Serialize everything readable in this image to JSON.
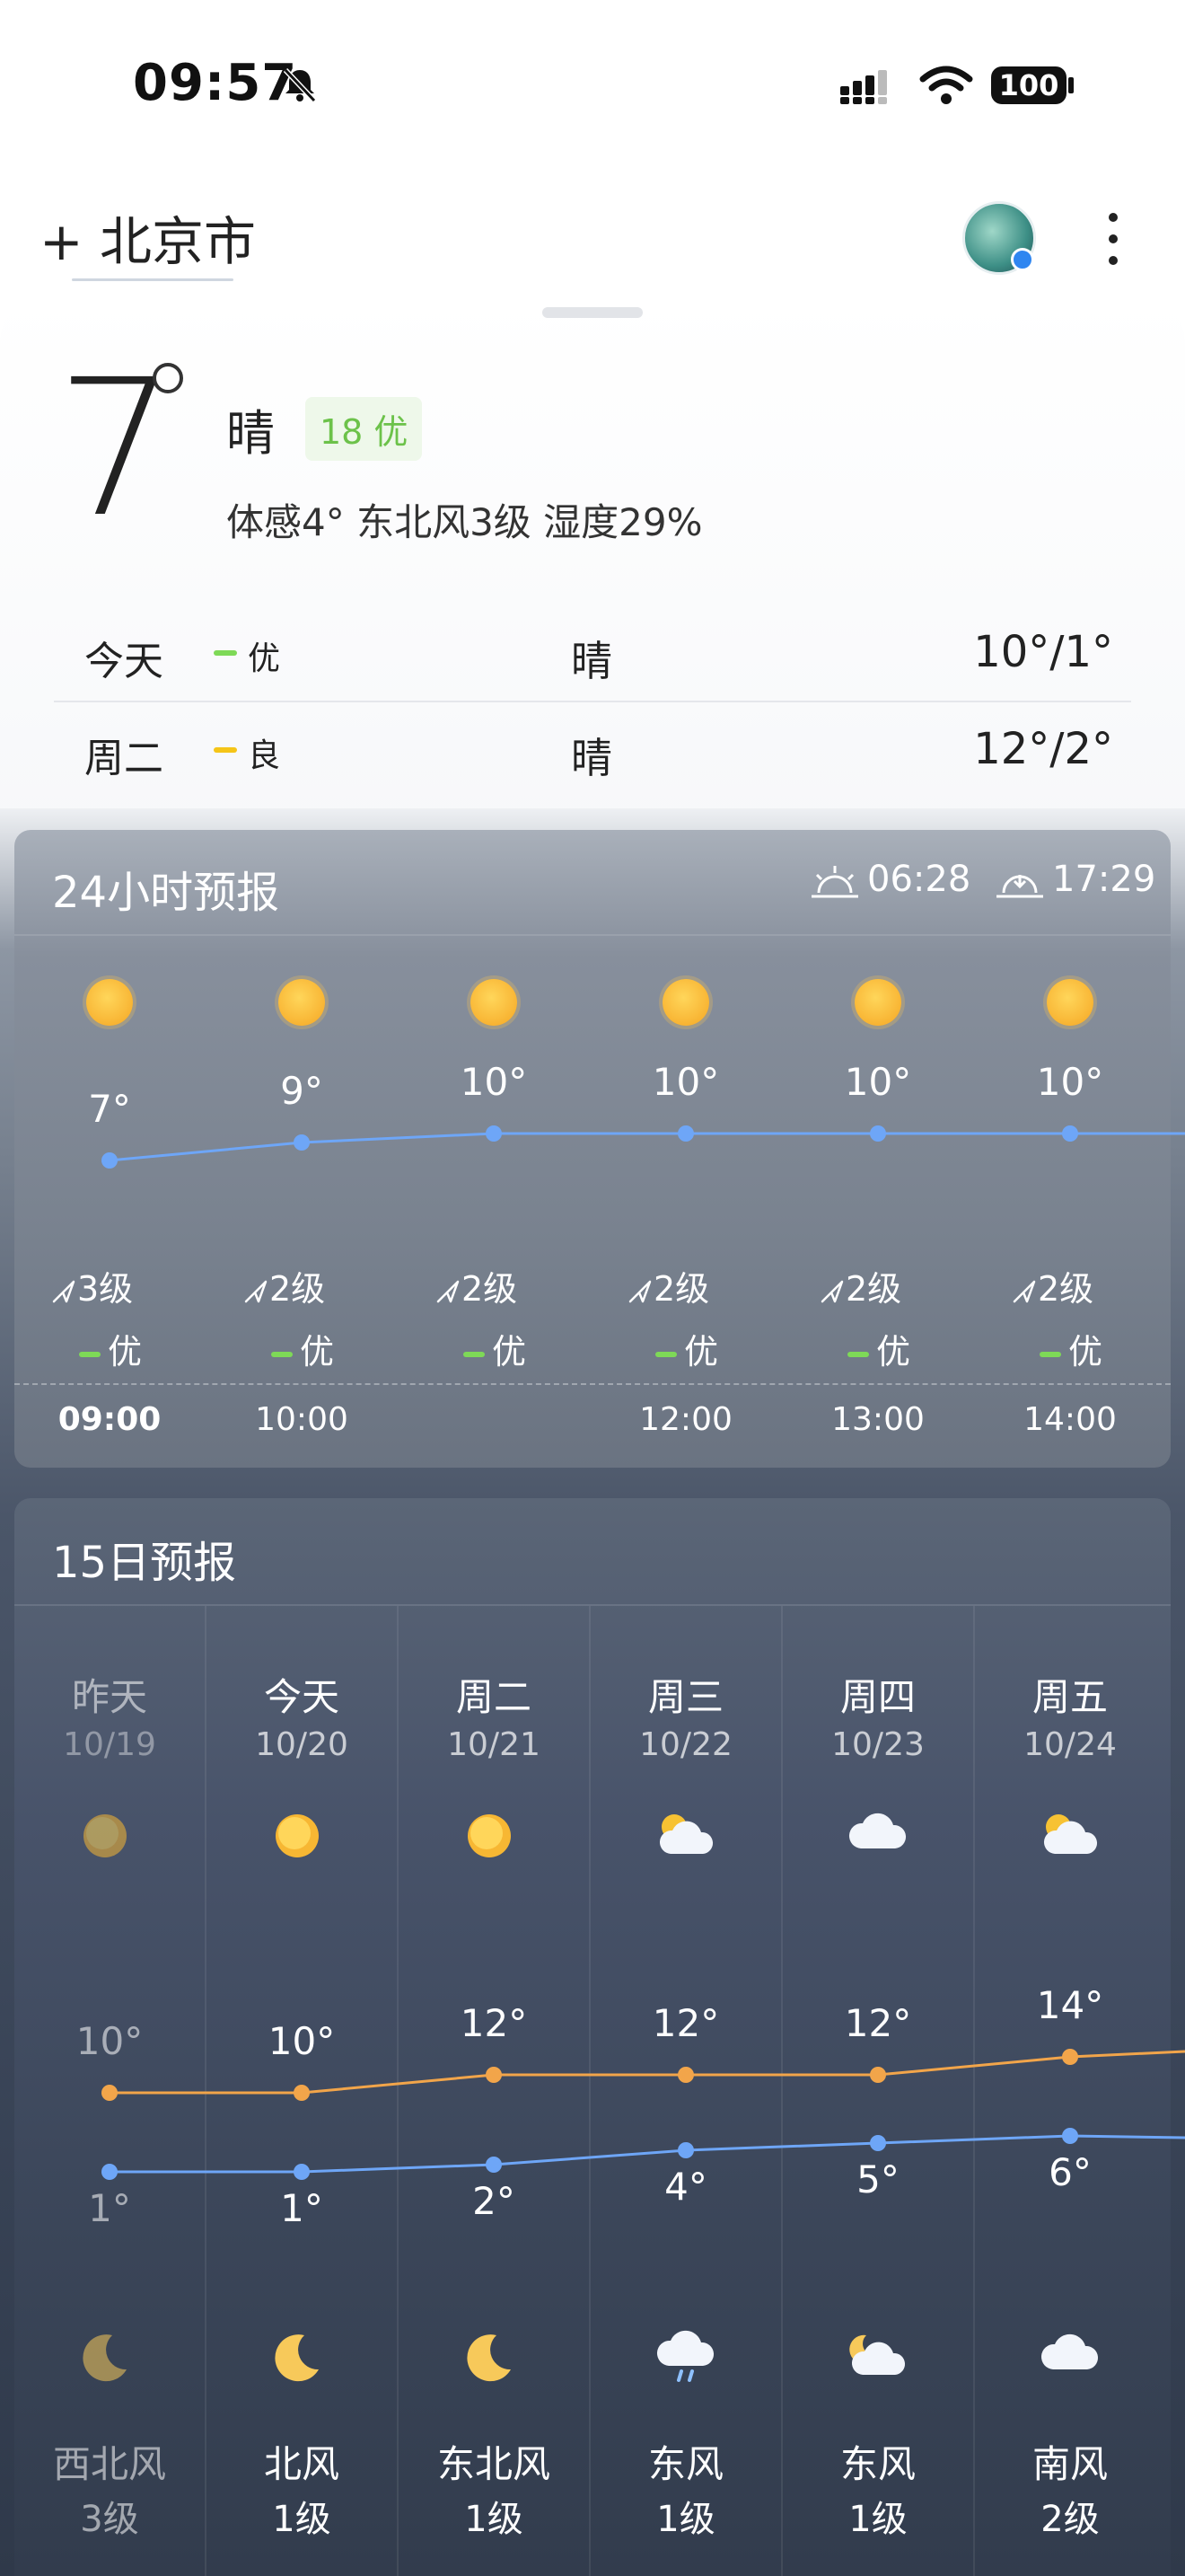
{
  "status_bar": {
    "time": "09:57",
    "battery": "100"
  },
  "header": {
    "city": "+ 北京市"
  },
  "current": {
    "temperature": "7",
    "condition": "晴",
    "aqi": "18 优",
    "details": "体感4° 东北风3级 湿度29%",
    "days": [
      {
        "name": "今天",
        "aqi": "优",
        "aqi_color": "#7ed957",
        "condition": "晴",
        "temps": "10°/1°"
      },
      {
        "name": "周二",
        "aqi": "良",
        "aqi_color": "#f5c518",
        "condition": "晴",
        "temps": "12°/2°"
      }
    ]
  },
  "hourly": {
    "title": "24小时预报",
    "sunrise": "06:28",
    "sunset": "17:29",
    "hours": [
      {
        "time": "09:00",
        "temp": "7°",
        "wind": "3级",
        "aqi": "优"
      },
      {
        "time": "10:00",
        "temp": "9°",
        "wind": "2级",
        "aqi": "优"
      },
      {
        "time": "",
        "temp": "10°",
        "wind": "2级",
        "aqi": "优"
      },
      {
        "time": "12:00",
        "temp": "10°",
        "wind": "2级",
        "aqi": "优"
      },
      {
        "time": "13:00",
        "temp": "10°",
        "wind": "2级",
        "aqi": "优"
      },
      {
        "time": "14:00",
        "temp": "10°",
        "wind": "2级",
        "aqi": "优"
      }
    ]
  },
  "daily": {
    "title": "15日预报",
    "days": [
      {
        "day": "昨天",
        "date": "10/19",
        "hi": "10°",
        "lo": "1°",
        "wind": "西北风",
        "level": "3级",
        "day_icon": "sun-icon",
        "night_icon": "moon-icon"
      },
      {
        "day": "今天",
        "date": "10/20",
        "hi": "10°",
        "lo": "1°",
        "wind": "北风",
        "level": "1级",
        "day_icon": "sun-icon",
        "night_icon": "moon-icon"
      },
      {
        "day": "周二",
        "date": "10/21",
        "hi": "12°",
        "lo": "2°",
        "wind": "东北风",
        "level": "1级",
        "day_icon": "sun-icon",
        "night_icon": "moon-icon"
      },
      {
        "day": "周三",
        "date": "10/22",
        "hi": "12°",
        "lo": "4°",
        "wind": "东风",
        "level": "1级",
        "day_icon": "partly-cloudy-icon",
        "night_icon": "rain-cloud-icon"
      },
      {
        "day": "周四",
        "date": "10/23",
        "hi": "12°",
        "lo": "5°",
        "wind": "东风",
        "level": "1级",
        "day_icon": "cloud-icon",
        "night_icon": "cloudy-night-icon"
      },
      {
        "day": "周五",
        "date": "10/24",
        "hi": "14°",
        "lo": "6°",
        "wind": "南风",
        "level": "2级",
        "day_icon": "partly-cloudy-icon",
        "night_icon": "cloud-icon"
      }
    ]
  }
}
